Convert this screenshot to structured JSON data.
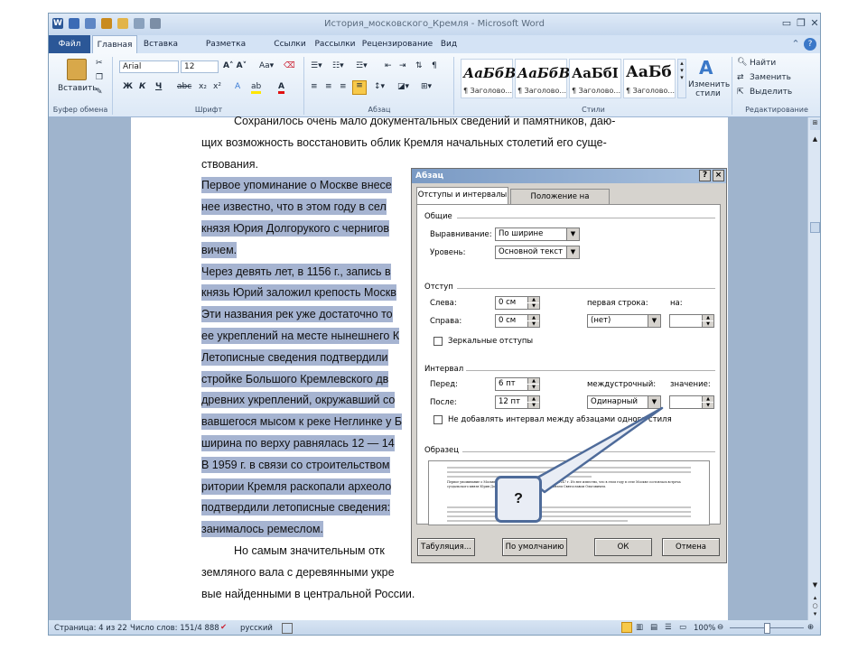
{
  "window": {
    "title": "История_московского_Кремля - Microsoft Word",
    "app_icon": "W"
  },
  "colors": {
    "file_tab": "#2b5797",
    "selection": "#a6b4d1",
    "dialog_bg": "#d6d3ce",
    "callout_border": "#4e6b9a"
  },
  "tabs": [
    "Файл",
    "Главная",
    "Вставка",
    "Разметка страницы",
    "Ссылки",
    "Рассылки",
    "Рецензирование",
    "Вид"
  ],
  "ribbon": {
    "paste_label": "Вставить",
    "font_name": "Arial",
    "font_size": "12",
    "styles": [
      {
        "sample": "АаБбВ",
        "name": "¶ Заголово..."
      },
      {
        "sample": "АаБбВ",
        "name": "¶ Заголово..."
      },
      {
        "sample": "АаБбI",
        "name": "¶ Заголово..."
      },
      {
        "sample": "АаБб",
        "name": "¶ Заголово..."
      }
    ],
    "change_styles": "Изменить стили",
    "find": "Найти",
    "replace": "Заменить",
    "select": "Выделить",
    "groups": [
      "Буфер обмена",
      "Шрифт",
      "Абзац",
      "Стили",
      "Редактирование"
    ]
  },
  "document": {
    "lines": [
      {
        "text": "Сохранилось очень мало документальных сведений и памятников, даю-",
        "hl": false
      },
      {
        "text": "щих возможность восстановить облик Кремля начальных столетий его суще-",
        "hl": false
      },
      {
        "text": "ствования.",
        "hl": false
      },
      {
        "text": "Первое упоминание о Москве внесе",
        "hl": true
      },
      {
        "text": "нее известно, что в этом году в сел",
        "hl": true
      },
      {
        "text": "князя Юрия Долгорукого с чернигов",
        "hl": true
      },
      {
        "text": "вичем.",
        "hl": true
      },
      {
        "text": "Через девять лет, в 1156 г., запись в",
        "hl": true
      },
      {
        "text": "князь Юрий заложил крепость Москв",
        "hl": true
      },
      {
        "text": "Эти названия рек уже достаточно то",
        "hl": true
      },
      {
        "text": "ее укреплений на месте нынешнего К",
        "hl": true
      },
      {
        "text": "Летописные сведения подтвердили",
        "hl": true
      },
      {
        "text": "стройке Большого Кремлевского дв",
        "hl": true
      },
      {
        "text": "древних укреплений, окружавший со",
        "hl": true
      },
      {
        "text": "вавшегося мысом к реке Неглинке у Б",
        "hl": true
      },
      {
        "text": "ширина по верху равнялась 12 — 14",
        "hl": true
      },
      {
        "text": "В 1959 г. в связи со строительством",
        "hl": true
      },
      {
        "text": "ритории Кремля раскопали археоло",
        "hl": true
      },
      {
        "text": "подтвердили летописные сведения:",
        "hl": true
      },
      {
        "text": "занималось ремеслом.",
        "hl": true
      },
      {
        "text": "Но самым значительным отк",
        "hl": false
      },
      {
        "text": "земляного вала с деревянными укре",
        "hl": false
      },
      {
        "text": "вые найденными в центральной России.",
        "hl": false
      }
    ]
  },
  "dialog": {
    "title": "Абзац",
    "help": "?",
    "close": "×",
    "tabs": [
      "Отступы и интервалы",
      "Положение на странице"
    ],
    "general": {
      "section": "Общие",
      "alignment_label": "Выравнивание:",
      "alignment_value": "По ширине",
      "level_label": "Уровень:",
      "level_value": "Основной текст"
    },
    "indent": {
      "section": "Отступ",
      "left_label": "Слева:",
      "left_value": "0 см",
      "right_label": "Справа:",
      "right_value": "0 см",
      "first_line_label": "первая строка:",
      "first_line_value": "(нет)",
      "by_label": "на:",
      "by_value": "",
      "mirror_label": "Зеркальные отступы"
    },
    "spacing": {
      "section": "Интервал",
      "before_label": "Перед:",
      "before_value": "6 пт",
      "after_label": "После:",
      "after_value": "12 пт",
      "line_label": "междустрочный:",
      "line_value": "Одинарный",
      "value_label": "значение:",
      "value_value": "",
      "no_space_label": "Не добавлять интервал между абзацами одного стиля"
    },
    "preview": {
      "section": "Образец",
      "text": "Первое упоминание о Москве внесено в Ипатьевскую летопись под 1147 г. Из нее известно, что в этом году в селе Москве состоялась встреча суздальского князя Юрия Долгорукого с чернигово-северским князем Святославом Ольговичем."
    },
    "buttons": {
      "tabs": "Табуляция...",
      "default": "По умолчанию",
      "ok": "ОК",
      "cancel": "Отмена"
    }
  },
  "callout": {
    "text": "?"
  },
  "status": {
    "page": "Страница: 4 из 22",
    "words": "Число слов: 151/4 888",
    "language": "русский",
    "zoom": "100%"
  }
}
